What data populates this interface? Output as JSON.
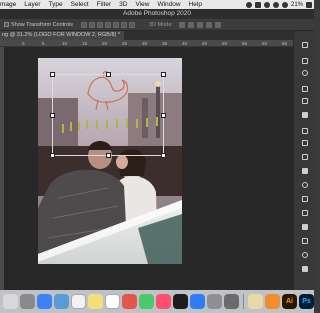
{
  "menubar": {
    "items": [
      "mage",
      "Layer",
      "Type",
      "Select",
      "Filter",
      "3D",
      "View",
      "Window",
      "Help"
    ],
    "battery": "21%"
  },
  "app": {
    "title": "Adobe Photoshop 2020"
  },
  "options": {
    "show_transform": "Show Transform Controls",
    "mode_3d": "3D Mode:"
  },
  "document": {
    "tab_label": "ng @ 31.2% (LOGO FOR WINDOW 2, RGB/8) *"
  },
  "ruler": {
    "ticks": [
      "0",
      "5",
      "10",
      "15",
      "20",
      "25",
      "30",
      "35",
      "40",
      "45",
      "50",
      "55",
      "60",
      "65"
    ]
  },
  "dock": {
    "ai_label": "Ai",
    "ps_label": "Ps"
  },
  "colors": {
    "ps_blue": "#31a8ff",
    "ai_orange": "#ff9a00",
    "workspace": "#282828"
  }
}
